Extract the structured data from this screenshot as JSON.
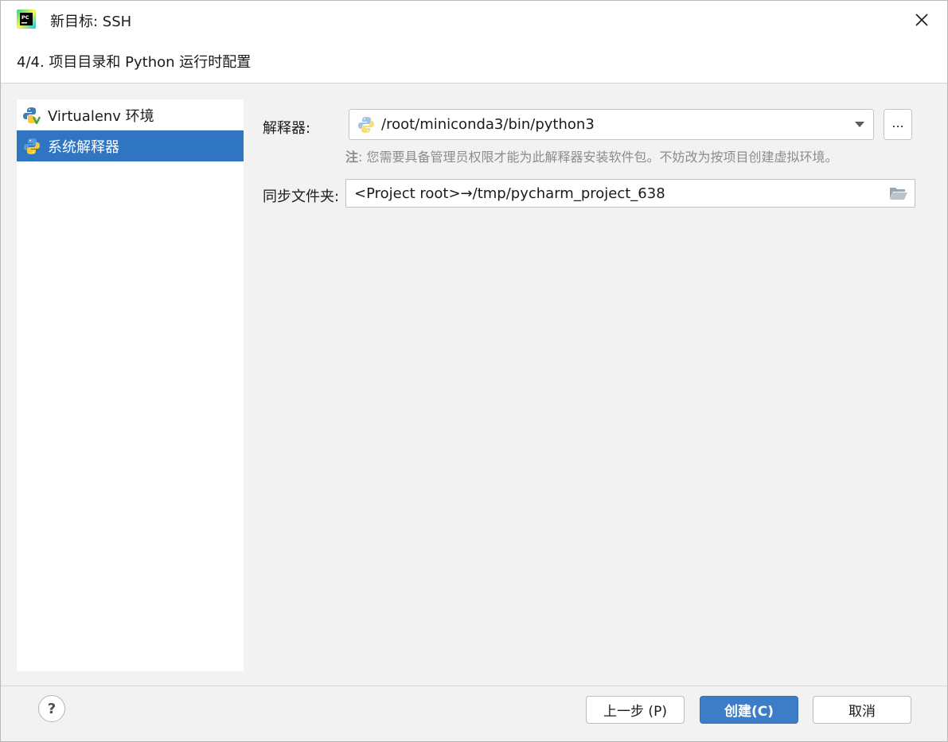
{
  "window": {
    "title": "新目标: SSH",
    "app_icon": "pycharm-icon",
    "close_icon": "close-icon"
  },
  "header": {
    "step_title": "4/4. 项目目录和 Python 运行时配置"
  },
  "sidebar": {
    "items": [
      {
        "label": "Virtualenv 环境",
        "icon": "python-virtualenv-icon",
        "selected": false
      },
      {
        "label": "系统解释器",
        "icon": "python-icon",
        "selected": true
      }
    ]
  },
  "form": {
    "interpreter_label": "解释器:",
    "interpreter_value": "/root/miniconda3/bin/python3",
    "browse_label": "...",
    "note_prefix": "注",
    "note_text": ": 您需要具备管理员权限才能为此解释器安装软件包。不妨改为按项目创建虚拟环境。",
    "sync_label": "同步文件夹:",
    "sync_value": "<Project root>→/tmp/pycharm_project_638"
  },
  "footer": {
    "help_label": "?",
    "back_label": "上一步 (P)",
    "create_label": "创建(C)",
    "cancel_label": "取消"
  },
  "colors": {
    "accent": "#2f75c1",
    "primary_button": "#3d7dc8",
    "background": "#f2f2f2"
  }
}
